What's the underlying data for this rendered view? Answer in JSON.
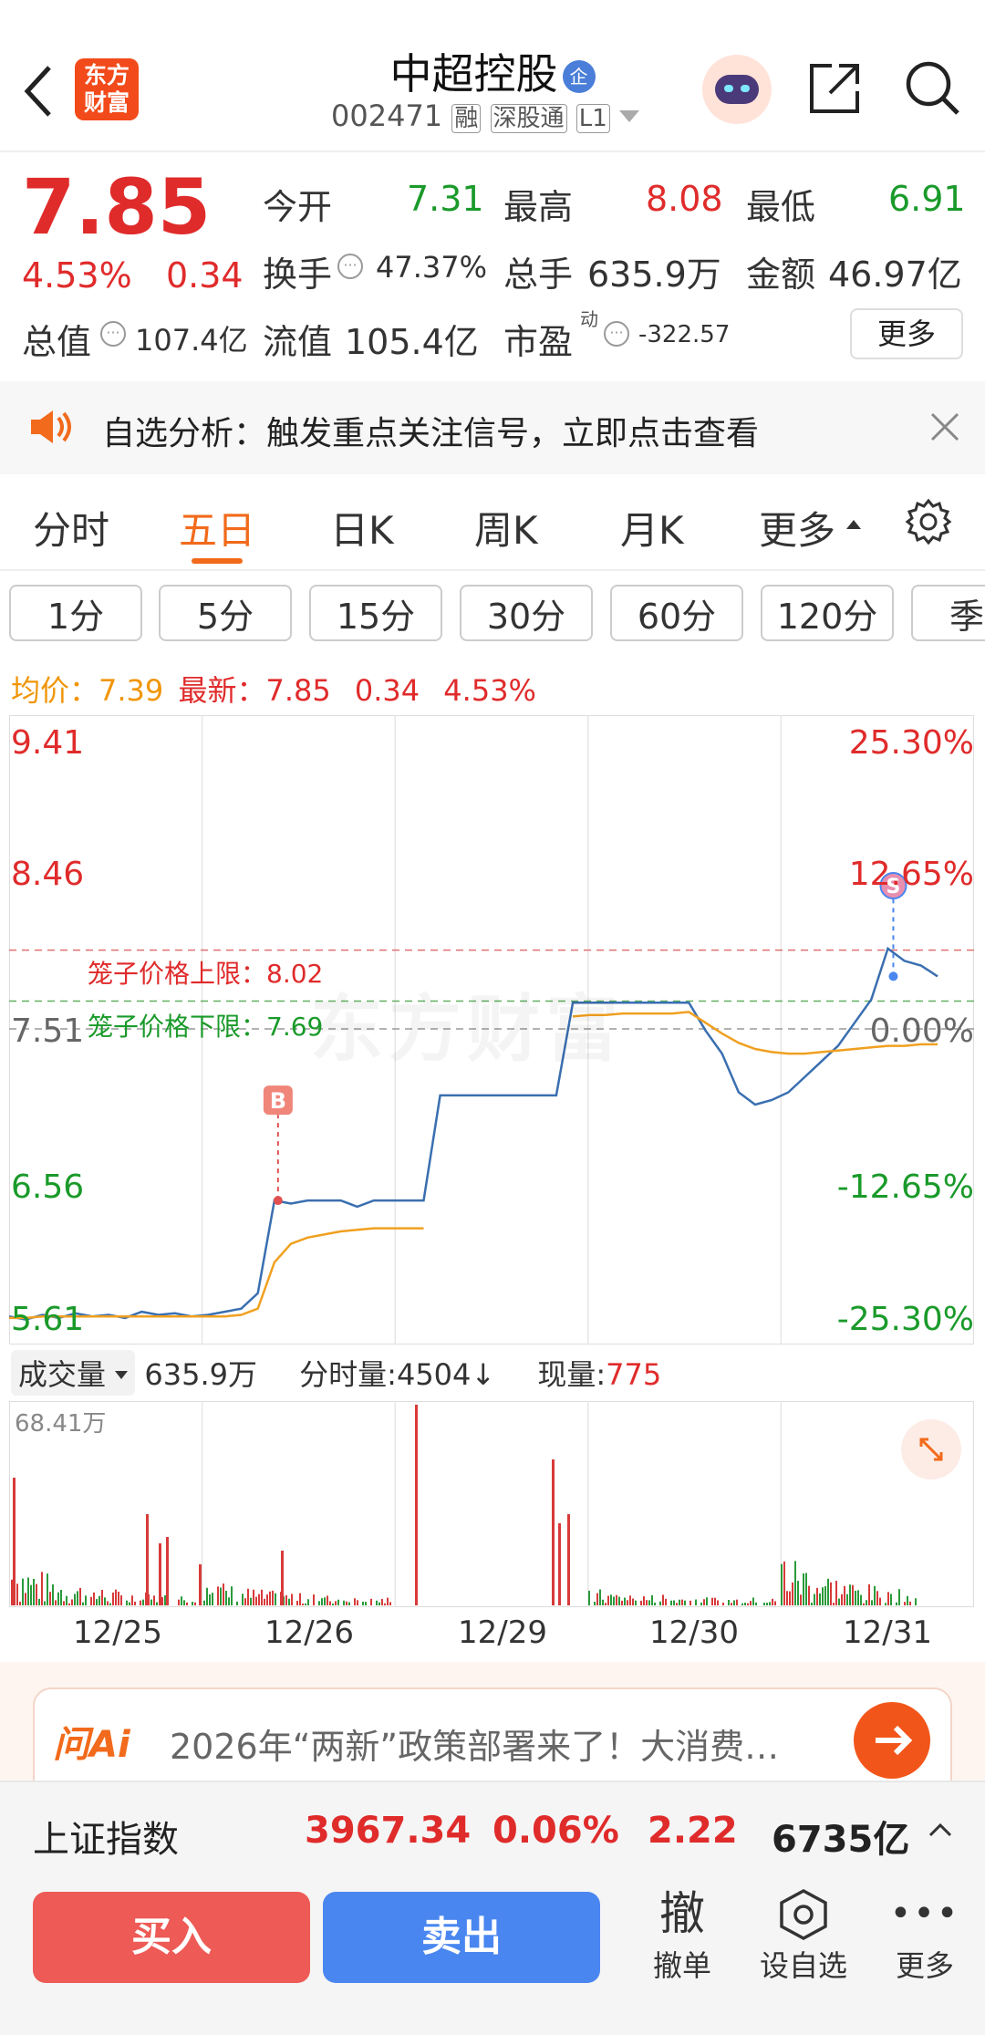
{
  "header": {
    "logo_text": "东方财富",
    "stock_name": "中超控股",
    "badge": "企",
    "code": "002471",
    "tags": [
      "融",
      "深股通",
      "L1"
    ]
  },
  "quote": {
    "price": "7.85",
    "change_pct": "4.53%",
    "change": "0.34",
    "open_label": "今开",
    "open": "7.31",
    "high_label": "最高",
    "high": "8.08",
    "low_label": "最低",
    "low": "6.91",
    "turnover_label": "换手",
    "turnover": "47.37%",
    "volume_label": "总手",
    "volume": "635.9万",
    "amount_label": "金额",
    "amount": "46.97亿",
    "mcap_label": "总值",
    "mcap": "107.4亿",
    "float_label": "流值",
    "float": "105.4亿",
    "pe_label": "市盈",
    "pe_sup": "动",
    "pe": "-322.57",
    "more": "更多"
  },
  "notice": {
    "text": "自选分析：触发重点关注信号，立即点击查看"
  },
  "tabs": [
    "分时",
    "五日",
    "日K",
    "周K",
    "月K",
    "更多"
  ],
  "active_tab": "五日",
  "periods": [
    "1分",
    "5分",
    "15分",
    "30分",
    "60分",
    "120分",
    "季"
  ],
  "info_line": {
    "avg_label": "均价：",
    "avg": "7.39",
    "latest_label": "最新：",
    "latest": "7.85",
    "change": "0.34",
    "pct": "4.53%"
  },
  "chart_data": {
    "type": "line",
    "x_days": [
      "12/25",
      "12/26",
      "12/29",
      "12/30",
      "12/31"
    ],
    "y_left_ticks": [
      "9.41",
      "8.46",
      "7.51",
      "6.56",
      "5.61"
    ],
    "y_right_ticks": [
      "25.30%",
      "12.65%",
      "0.00%",
      "-12.65%",
      "-25.30%"
    ],
    "ylim": [
      5.61,
      9.41
    ],
    "upper_limit_label": "笼子价格上限：8.02",
    "lower_limit_label": "笼子价格下限：7.69",
    "upper_limit": 8.02,
    "lower_limit": 7.69,
    "buy_marker": "B",
    "sell_marker": "S",
    "watermark": "东方财富",
    "series": [
      {
        "name": "价格",
        "color": "#3a6fb0",
        "values": [
          5.65,
          5.63,
          5.66,
          5.64,
          5.67,
          5.65,
          5.66,
          5.64,
          5.68,
          5.66,
          5.67,
          5.65,
          5.66,
          5.68,
          5.7,
          5.8,
          6.4,
          6.38,
          6.4,
          6.4,
          6.4,
          6.36,
          6.4,
          6.4,
          6.4,
          6.4,
          7.08,
          7.08,
          7.08,
          7.08,
          7.08,
          7.08,
          7.08,
          7.08,
          7.68,
          7.68,
          7.68,
          7.68,
          7.68,
          7.68,
          7.68,
          7.68,
          7.5,
          7.35,
          7.1,
          7.02,
          7.05,
          7.1,
          7.2,
          7.3,
          7.4,
          7.55,
          7.7,
          8.03,
          7.95,
          7.92,
          7.85
        ]
      },
      {
        "name": "均价",
        "color": "#f0a020",
        "values": [
          5.64,
          5.64,
          5.65,
          5.65,
          5.65,
          5.65,
          5.65,
          5.65,
          5.65,
          5.65,
          5.65,
          5.65,
          5.65,
          5.65,
          5.66,
          5.7,
          6.0,
          6.12,
          6.16,
          6.18,
          6.2,
          6.21,
          6.22,
          6.22,
          6.22,
          6.22,
          null,
          null,
          null,
          null,
          null,
          null,
          null,
          null,
          7.59,
          7.6,
          7.6,
          7.61,
          7.61,
          7.61,
          7.61,
          7.62,
          7.55,
          7.48,
          7.42,
          7.38,
          7.36,
          7.35,
          7.35,
          7.36,
          7.37,
          7.38,
          7.39,
          7.4,
          7.4,
          7.41,
          7.41
        ]
      }
    ]
  },
  "volume": {
    "label": "成交量",
    "total": "635.9万",
    "tick_label": "分时量:",
    "tick": "4504",
    "now_label": "现量:",
    "now": "775",
    "max": "68.41万"
  },
  "ad": {
    "brand": "问Ai",
    "text": "2026年“两新”政策部署来了！大消费…"
  },
  "index_bar": {
    "name": "上证指数",
    "value": "3967.34",
    "pct": "0.06%",
    "change": "2.22",
    "amount": "6735亿"
  },
  "bottom": {
    "buy": "买入",
    "sell": "卖出",
    "cancel_icon": "撤",
    "cancel": "撤单",
    "watch": "设自选",
    "more": "更多"
  },
  "colors": {
    "up": "#e02b2b",
    "down": "#1a9a2a",
    "accent": "#f0960a",
    "price_line": "#3a6fb0"
  }
}
